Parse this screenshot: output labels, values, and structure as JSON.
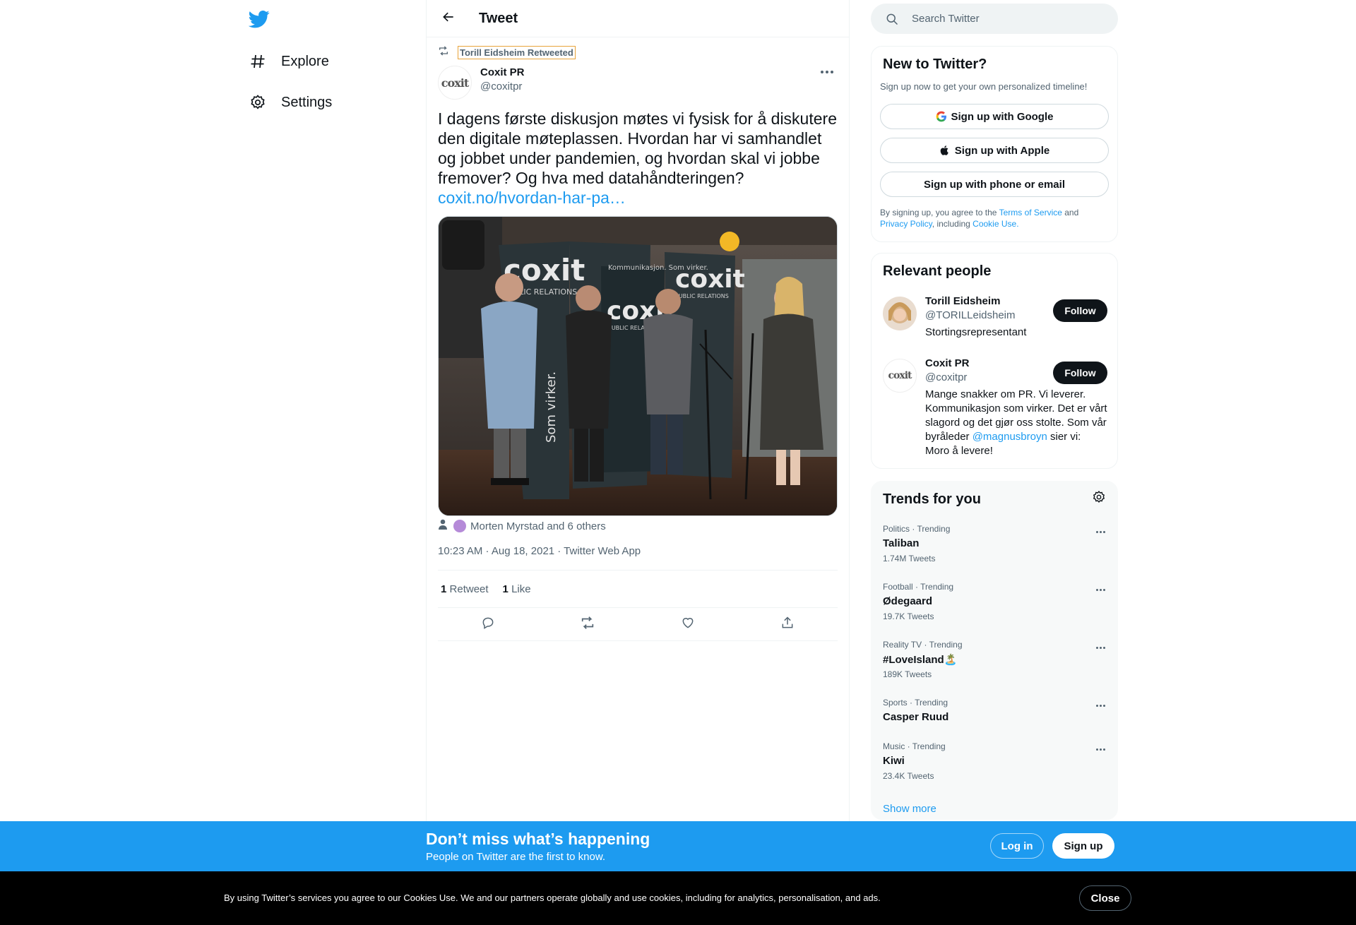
{
  "colors": {
    "accent": "#1d9bf0",
    "text": "#0f1419",
    "muted": "#536471",
    "cookie_bar": "#000000"
  },
  "nav": {
    "logo_icon": "twitter-bird-icon",
    "items": [
      {
        "label": "Explore",
        "icon": "hashtag-icon"
      },
      {
        "label": "Settings",
        "icon": "gear-icon"
      }
    ]
  },
  "header": {
    "title": "Tweet",
    "back_icon": "arrow-left-icon"
  },
  "tweet": {
    "retweeted_by": "Torill Eidsheim Retweeted",
    "author_name": "Coxit PR",
    "author_handle": "@coxitpr",
    "avatar_text": "coxit",
    "text": "I dagens første diskusjon møtes vi fysisk for å diskutere den digitale møteplassen. Hvordan har vi samhandlet og jobbet under pandemien, og hvordan skal vi jobbe fremover? Og hva med datahåndteringen?",
    "link": "coxit.no/hvordan-har-pa…",
    "tagged_people": "Morten Myrstad and 6 others",
    "timestamp": "10:23 AM · Aug 18, 2021 · Twitter Web App",
    "retweets_count": "1",
    "retweets_label": "Retweet",
    "likes_count": "1",
    "likes_label": "Like",
    "photo_banners": [
      "coxit",
      "PUBLIC RELATIONS",
      "Kommunikasjon. Som virker.",
      "Som virker."
    ]
  },
  "search": {
    "placeholder": "Search Twitter"
  },
  "new_to_twitter": {
    "title": "New to Twitter?",
    "subtitle": "Sign up now to get your own personalized timeline!",
    "google": "Sign up with Google",
    "apple": "Sign up with Apple",
    "phone_email": "Sign up with phone or email",
    "legal_pre": "By signing up, you agree to the ",
    "tos": "Terms of Service",
    "and": " and ",
    "privacy": "Privacy Policy",
    "including": ", including ",
    "cookie_use": "Cookie Use."
  },
  "relevant_people": {
    "title": "Relevant people",
    "people": [
      {
        "name": "Torill Eidsheim",
        "handle": "@TORILLeidsheim",
        "bio": "Stortingsrepresentant",
        "follow": "Follow"
      },
      {
        "name": "Coxit PR",
        "handle": "@coxitpr",
        "bio_pre": "Mange snakker om PR. Vi leverer. Kommunikasjon som virker. Det er vårt slagord og det gjør oss stolte. Som vår byråleder ",
        "bio_mention": "@magnusbroyn",
        "bio_post": " sier vi: Moro å levere!",
        "follow": "Follow"
      }
    ]
  },
  "trends": {
    "title": "Trends for you",
    "items": [
      {
        "meta": "Politics · Trending",
        "name": "Taliban",
        "count": "1.74M Tweets"
      },
      {
        "meta": "Football · Trending",
        "name": "Ødegaard",
        "count": "19.7K Tweets"
      },
      {
        "meta": "Reality TV · Trending",
        "name": "#LoveIsland🏝️",
        "count": "189K Tweets"
      },
      {
        "meta": "Sports · Trending",
        "name": "Casper Ruud",
        "count": ""
      },
      {
        "meta": "Music · Trending",
        "name": "Kiwi",
        "count": "23.4K Tweets"
      }
    ],
    "show_more": "Show more"
  },
  "bottom_bar": {
    "title": "Don’t miss what’s happening",
    "subtitle": "People on Twitter are the first to know.",
    "login": "Log in",
    "signup": "Sign up"
  },
  "cookie_bar": {
    "text": "By using Twitter’s services you agree to our Cookies Use. We and our partners operate globally and use cookies, including for analytics, personalisation, and ads.",
    "close": "Close"
  }
}
